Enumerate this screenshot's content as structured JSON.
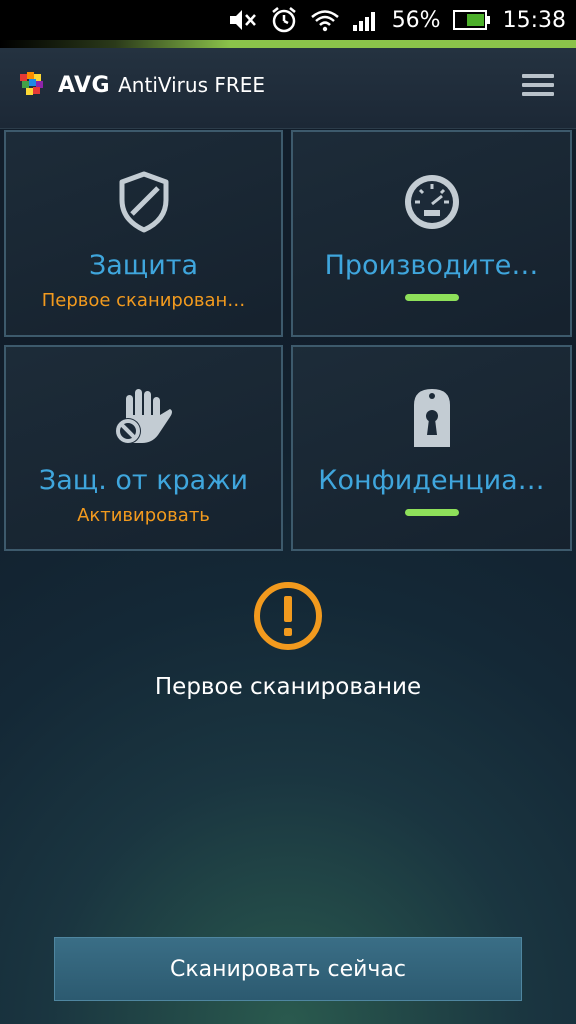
{
  "status_bar": {
    "battery_percent": "56%",
    "time": "15:38"
  },
  "app": {
    "brand": "AVG",
    "product": "AntiVirus FREE"
  },
  "tiles": [
    {
      "title": "Защита",
      "subtitle": "Первое сканирован…",
      "icon": "shield-icon"
    },
    {
      "title": "Производите…",
      "subtitle": "",
      "icon": "speedometer-icon",
      "status_bar_color": "#8ee05a"
    },
    {
      "title": "Защ. от кражи",
      "subtitle": "Активировать",
      "icon": "hand-block-icon"
    },
    {
      "title": "Конфиденциа…",
      "subtitle": "",
      "icon": "keyhole-lock-icon",
      "status_bar_color": "#8ee05a"
    }
  ],
  "warning": {
    "icon": "warning-circle-icon",
    "message": "Первое сканирование",
    "color": "#f29a1e"
  },
  "scan_button": {
    "label": "Сканировать сейчас"
  },
  "colors": {
    "accent_blue": "#3fa6dd",
    "accent_orange": "#f29a1e",
    "accent_green": "#8ee05a"
  }
}
